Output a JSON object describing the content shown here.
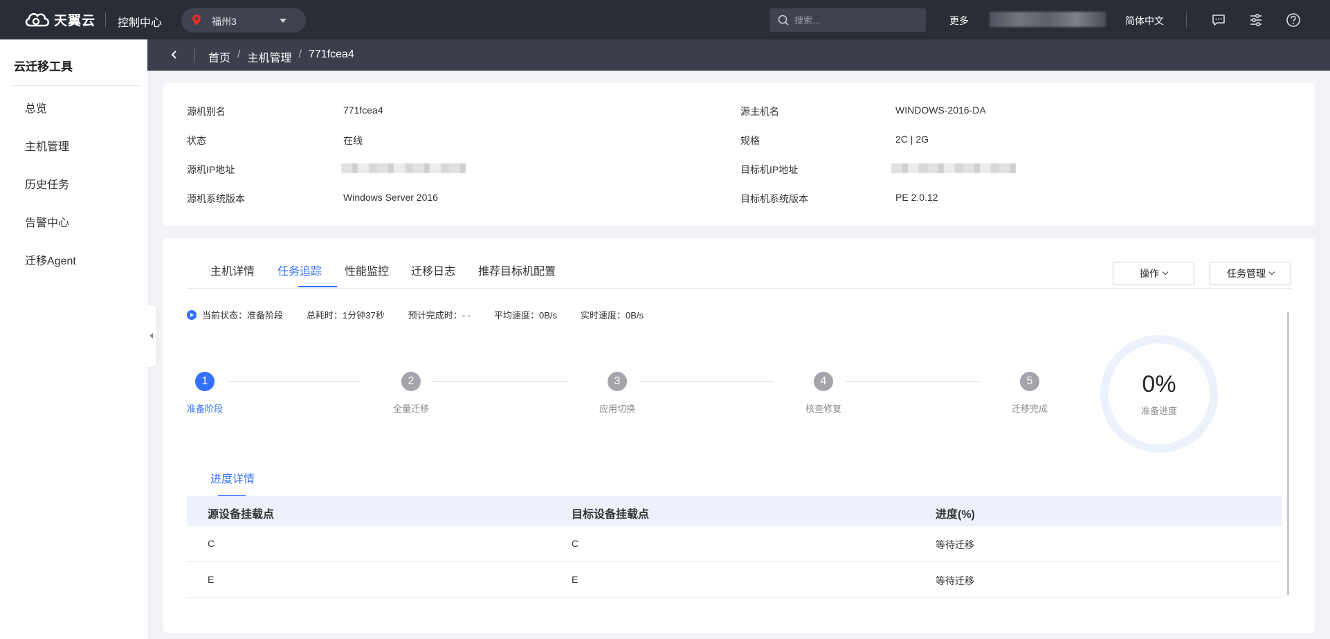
{
  "topbar": {
    "logo_text": "天翼云",
    "console": "控制中心",
    "region": "福州3",
    "search_placeholder": "搜索...",
    "more": "更多",
    "language": "简体中文",
    "icons": [
      "message-icon",
      "settings-icon",
      "help-icon"
    ]
  },
  "sidebar": {
    "title": "云迁移工具",
    "items": [
      "总览",
      "主机管理",
      "历史任务",
      "告警中心",
      "迁移Agent"
    ]
  },
  "breadcrumb": {
    "items": [
      "首页",
      "主机管理",
      "771fcea4"
    ],
    "separator": "/"
  },
  "info": {
    "left": [
      {
        "key": "源机别名",
        "value": "771fcea4"
      },
      {
        "key": "状态",
        "value": "在线"
      },
      {
        "key": "源机IP地址",
        "value": ""
      },
      {
        "key": "源机系统版本",
        "value": "Windows Server 2016"
      }
    ],
    "right": [
      {
        "key": "源主机名",
        "value": "WINDOWS-2016-DA"
      },
      {
        "key": "规格",
        "value": "2C | 2G"
      },
      {
        "key": "目标机IP地址",
        "value": ""
      },
      {
        "key": "目标机系统版本",
        "value": "PE 2.0.12"
      }
    ]
  },
  "tabs": {
    "items": [
      "主机详情",
      "任务追踪",
      "性能监控",
      "迁移日志",
      "推荐目标机配置"
    ],
    "active": "任务追踪"
  },
  "buttons": {
    "operate": "操作",
    "task_manage": "任务管理"
  },
  "status": {
    "current": "当前状态：准备阶段",
    "elapsed": "总耗时：1分钟37秒",
    "eta": "预计完成时：- -",
    "avg_speed": "平均速度：0B/s",
    "realtime_speed": "实时速度：0B/s"
  },
  "steps": [
    {
      "num": "1",
      "label": "准备阶段",
      "active": true
    },
    {
      "num": "2",
      "label": "全量迁移",
      "active": false
    },
    {
      "num": "3",
      "label": "应用切换",
      "active": false
    },
    {
      "num": "4",
      "label": "核查修复",
      "active": false
    },
    {
      "num": "5",
      "label": "迁移完成",
      "active": false
    }
  ],
  "progress": {
    "value": "0%",
    "fraction": 0,
    "label": "准备进度"
  },
  "detail": {
    "tab": "进度详情",
    "columns": [
      "源设备挂载点",
      "目标设备挂载点",
      "进度(%)"
    ],
    "rows": [
      [
        "C",
        "C",
        "等待迁移"
      ],
      [
        "E",
        "E",
        "等待迁移"
      ]
    ]
  },
  "colors": {
    "topbar": "#2a2d36",
    "breadcrumb_bar": "#3b3f4b",
    "accent": "#3370ff",
    "region_pin": "#e0302a"
  }
}
